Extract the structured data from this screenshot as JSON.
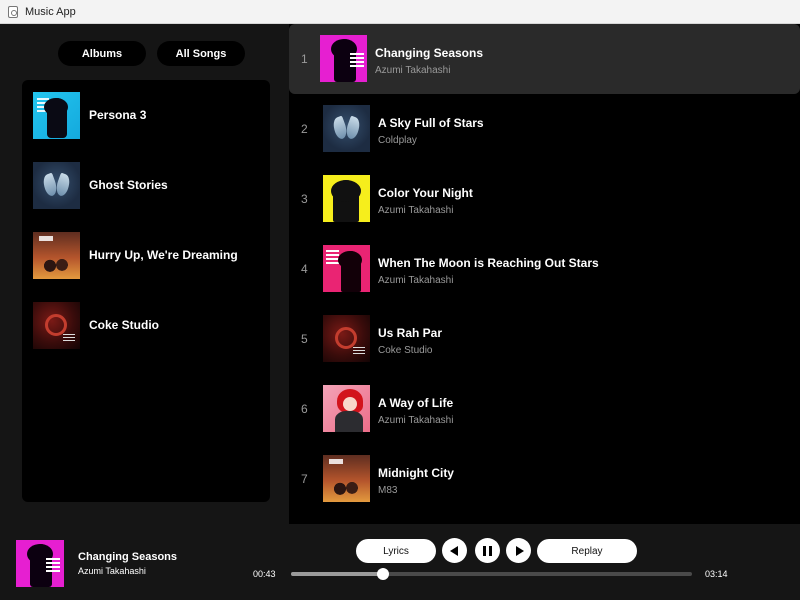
{
  "window": {
    "title": "Music App",
    "icon": "music-app-icon"
  },
  "tabs": {
    "albums": "Albums",
    "all_songs": "All Songs"
  },
  "albums": [
    {
      "label": "Persona 3",
      "art": "p3"
    },
    {
      "label": "Ghost Stories",
      "art": "gs"
    },
    {
      "label": "Hurry Up, We're Dreaming",
      "art": "m83"
    },
    {
      "label": "Coke Studio",
      "art": "coke"
    }
  ],
  "songs": [
    {
      "num": "1",
      "title": "Changing Seasons",
      "artist": "Azumi Takahashi",
      "art": "magenta",
      "active": true
    },
    {
      "num": "2",
      "title": "A Sky Full of Stars",
      "artist": "Coldplay",
      "art": "gs",
      "active": false
    },
    {
      "num": "3",
      "title": "Color Your Night",
      "artist": "Azumi Takahashi",
      "art": "yellow",
      "active": false
    },
    {
      "num": "4",
      "title": "When The Moon is Reaching Out Stars",
      "artist": "Azumi Takahashi",
      "art": "pink",
      "active": false
    },
    {
      "num": "5",
      "title": "Us Rah Par",
      "artist": "Coke Studio",
      "art": "coke",
      "active": false
    },
    {
      "num": "6",
      "title": "A Way of Life",
      "artist": "Azumi Takahashi",
      "art": "red",
      "active": false
    },
    {
      "num": "7",
      "title": "Midnight City",
      "artist": "M83",
      "art": "m83",
      "active": false
    }
  ],
  "player": {
    "title": "Changing Seasons",
    "artist": "Azumi Takahashi",
    "lyrics_label": "Lyrics",
    "replay_label": "Replay",
    "current_time": "00:43",
    "total_time": "03:14",
    "progress": 0.23
  },
  "colors": {
    "background": "#000000",
    "panel": "#151515",
    "active_row": "#2a2a2a",
    "muted_text": "#9a9a9a"
  }
}
